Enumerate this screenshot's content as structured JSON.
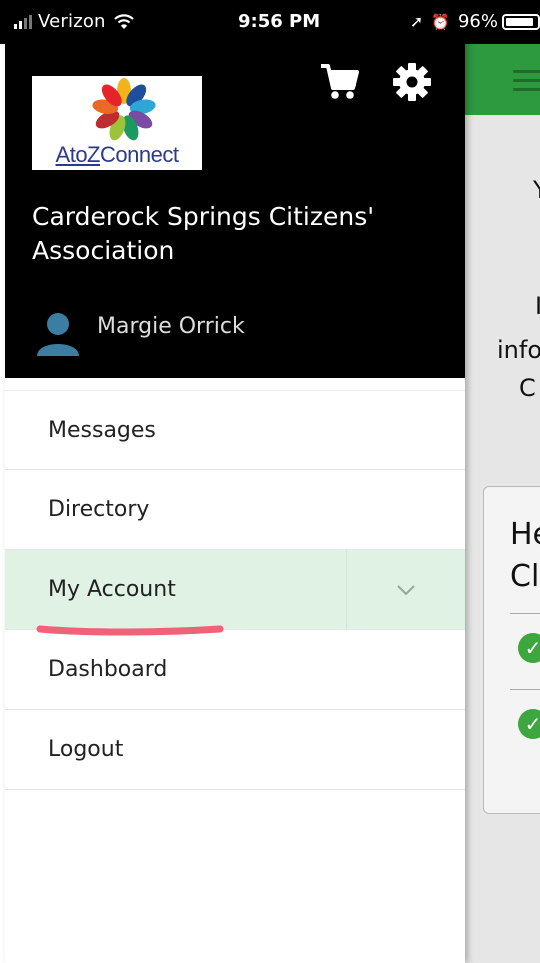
{
  "status_bar": {
    "carrier": "Verizon",
    "time": "9:56 PM",
    "battery_pct": "96%",
    "icons": [
      "signal-icon",
      "wifi-icon",
      "location-arrow-icon",
      "alarm-icon",
      "battery-icon"
    ]
  },
  "drawer": {
    "logo_text_prefix": "AtoZ",
    "logo_text_suffix": "Connect",
    "org_name": "Carderock Springs Citizens' Association",
    "user_name": "Margie Orrick",
    "header_icons": [
      "cart-icon",
      "gear-icon"
    ],
    "menu": [
      {
        "label": "Messages",
        "active": false
      },
      {
        "label": "Directory",
        "active": false
      },
      {
        "label": "My Account",
        "active": true
      },
      {
        "label": "Dashboard",
        "active": false
      },
      {
        "label": "Logout",
        "active": false
      }
    ]
  },
  "background_app": {
    "fragments": [
      "Y",
      "I",
      "info",
      "C"
    ],
    "card_title_1": "He",
    "card_title_2": "Cl"
  },
  "colors": {
    "header_bg": "#000000",
    "active_item_bg": "#dff2e4",
    "topbar_green": "#2e9a3f",
    "annotation_pink": "#f06277"
  }
}
